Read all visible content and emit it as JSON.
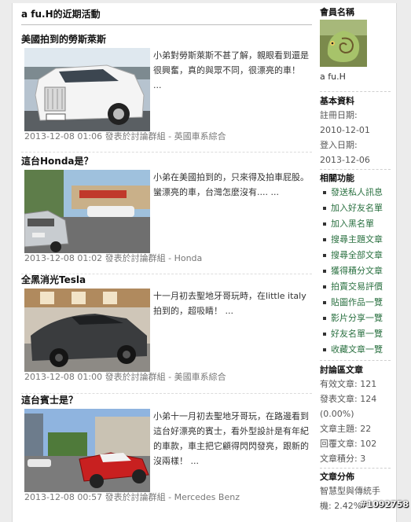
{
  "main": {
    "title": "a fu.H的近期活動",
    "posts": [
      {
        "title": "美國拍到的勞斯萊斯",
        "excerpt": "小弟對勞斯萊斯不甚了解，親眼看到還是很興奮，真的與眾不同，很漂亮的車！ ...",
        "meta": "2013-12-08 01:06 發表於討論群組 - 英國車系綜合"
      },
      {
        "title": "這台Honda是？",
        "excerpt": "小弟在美國拍到的，只來得及拍車屁股。 蠻漂亮的車，台灣怎麼沒有.... ...",
        "meta": "2013-12-08 01:02 發表於討論群組 - Honda"
      },
      {
        "title": "全黑消光Tesla",
        "excerpt": "十一月初去聖地牙哥玩時，在little italy拍到的，超吸睛！ ...",
        "meta": "2013-12-08 01:00 發表於討論群組 - 美國車系綜合"
      },
      {
        "title": "這台賓士是？",
        "excerpt": "小弟十一月初去聖地牙哥玩，在路邊看到這台好漂亮的賓士，看外型設計是有年紀的車款，車主把它顧得閃閃發亮，跟新的沒兩樣！ ...",
        "meta": "2013-12-08 00:57 發表於討論群組 - Mercedes Benz"
      }
    ]
  },
  "sidebar": {
    "member_heading": "會員名稱",
    "member_name": "a fu.H",
    "basic_heading": "基本資料",
    "reg_label": "註冊日期:",
    "reg_date": "2010-12-01",
    "login_label": "登入日期:",
    "login_date": "2013-12-06",
    "func_heading": "相關功能",
    "functions": [
      "發送私人訊息",
      "加入好友名單",
      "加入黑名單",
      "搜尋主題文章",
      "搜尋全部文章",
      "獲得積分文章",
      "拍賣交易評價",
      "貼圖作品一覽",
      "影片分享一覽",
      "好友名單一覽",
      "收藏文章一覽"
    ],
    "forum_heading": "討論區文章",
    "stats": [
      "有效文章: 121",
      "發表文章: 124",
      "(0.00%)",
      "文章主題: 22",
      "回覆文章: 102",
      "文章積分: 3"
    ],
    "dist_heading": "文章分佈",
    "dist_line1": "智慧型與傳統手",
    "dist_line2": "機: 2.42%"
  },
  "watermark": "#1092758",
  "colors": {
    "link_green": "#2a7040",
    "meta_gray": "#777777"
  }
}
